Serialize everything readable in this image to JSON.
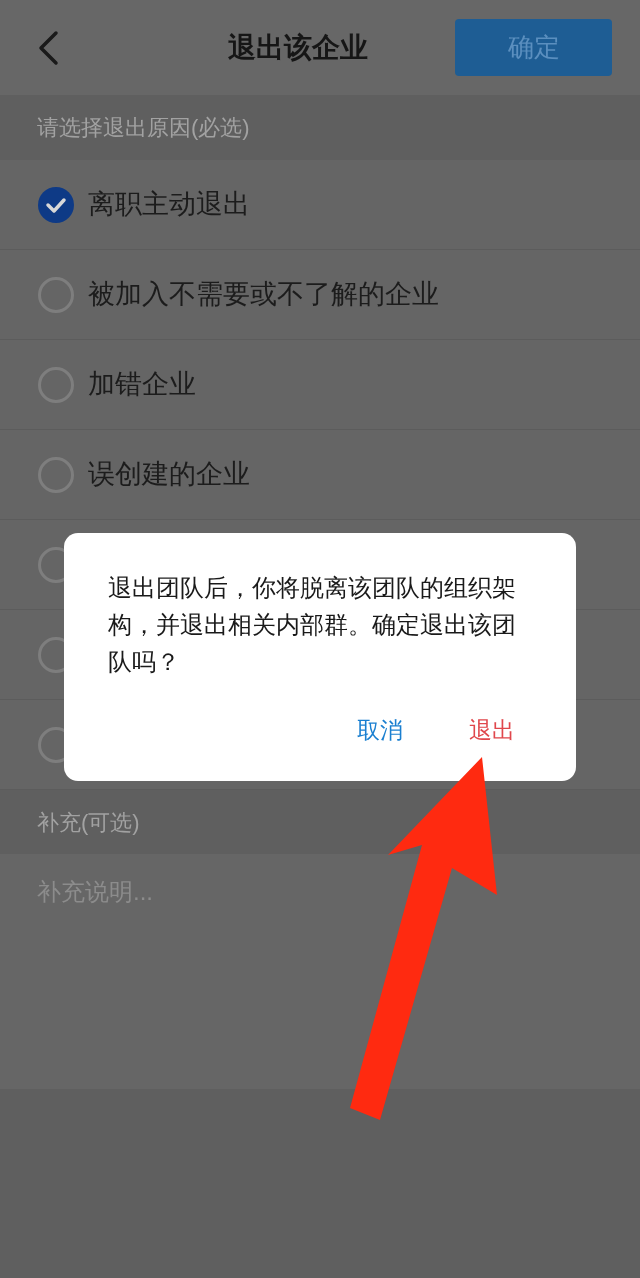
{
  "header": {
    "title": "退出该企业",
    "confirm": "确定"
  },
  "reasons": {
    "heading": "请选择退出原因(必选)",
    "options": [
      {
        "label": "离职主动退出",
        "selected": true
      },
      {
        "label": "被加入不需要或不了解的企业",
        "selected": false
      },
      {
        "label": "加错企业",
        "selected": false
      },
      {
        "label": "误创建的企业",
        "selected": false
      },
      {
        "selected": false
      },
      {
        "selected": false
      },
      {
        "selected": false
      }
    ]
  },
  "supplement": {
    "heading": "补充(可选)",
    "placeholder": "补充说明..."
  },
  "dialog": {
    "message": "退出团队后，你将脱离该团队的组织架构，并退出相关内部群。确定退出该团队吗？",
    "buttons": [
      {
        "label": "取消",
        "kind": "cancel"
      },
      {
        "label": "退出",
        "kind": "danger"
      }
    ]
  }
}
